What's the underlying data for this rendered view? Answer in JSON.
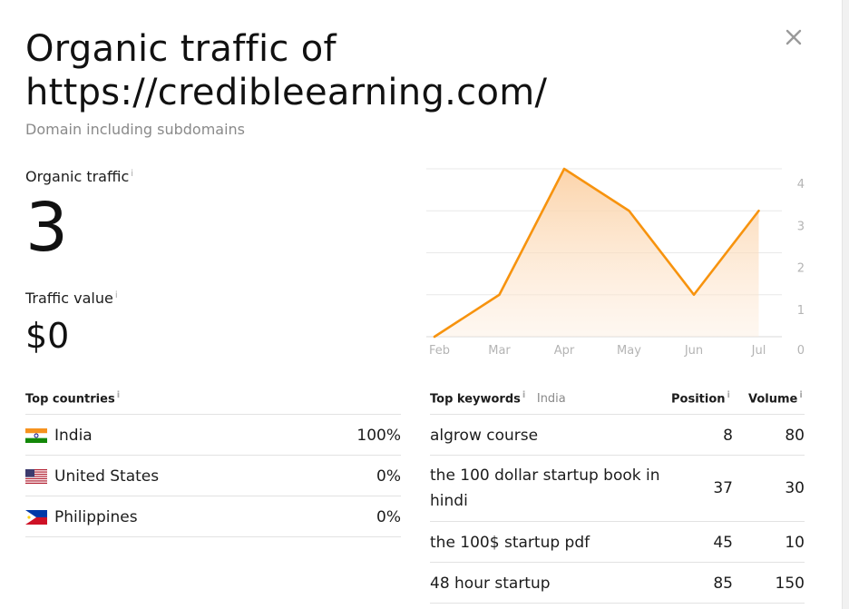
{
  "header": {
    "title_line1": "Organic traffic of",
    "title_line2": "https://credibleearning.com/",
    "subtitle": "Domain including subdomains"
  },
  "metrics": {
    "traffic_label": "Organic traffic",
    "traffic_value": "3",
    "value_label": "Traffic value",
    "value_amount": "$0",
    "info_glyph": "i"
  },
  "chart_data": {
    "type": "area",
    "x": [
      "Feb",
      "Mar",
      "Apr",
      "May",
      "Jun",
      "Jul"
    ],
    "values": [
      0,
      1,
      4,
      3,
      1,
      3
    ],
    "y_ticks": [
      "0",
      "1",
      "2",
      "3",
      "4"
    ],
    "ylim": [
      0,
      4
    ],
    "grid": true,
    "y_axis_side": "right",
    "line_color": "#f7930e",
    "fill_color": "#fbd7b3"
  },
  "countries": {
    "header": "Top countries",
    "rows": [
      {
        "name": "India",
        "pct": "100%",
        "flag": "flag-india"
      },
      {
        "name": "United States",
        "pct": "0%",
        "flag": "flag-us"
      },
      {
        "name": "Philippines",
        "pct": "0%",
        "flag": "flag-philippines"
      }
    ]
  },
  "keywords": {
    "header": "Top keywords",
    "country": "India",
    "position_header": "Position",
    "volume_header": "Volume",
    "rows": [
      {
        "term": "algrow course",
        "position": "8",
        "volume": "80"
      },
      {
        "term": "the 100 dollar startup book in hindi",
        "position": "37",
        "volume": "30"
      },
      {
        "term": "the 100$ startup pdf",
        "position": "45",
        "volume": "10"
      },
      {
        "term": "48 hour startup",
        "position": "85",
        "volume": "150"
      }
    ]
  },
  "colors": {
    "accent": "#f7930e",
    "muted_text": "#8a8a8a",
    "divider": "#e2e2e2"
  }
}
